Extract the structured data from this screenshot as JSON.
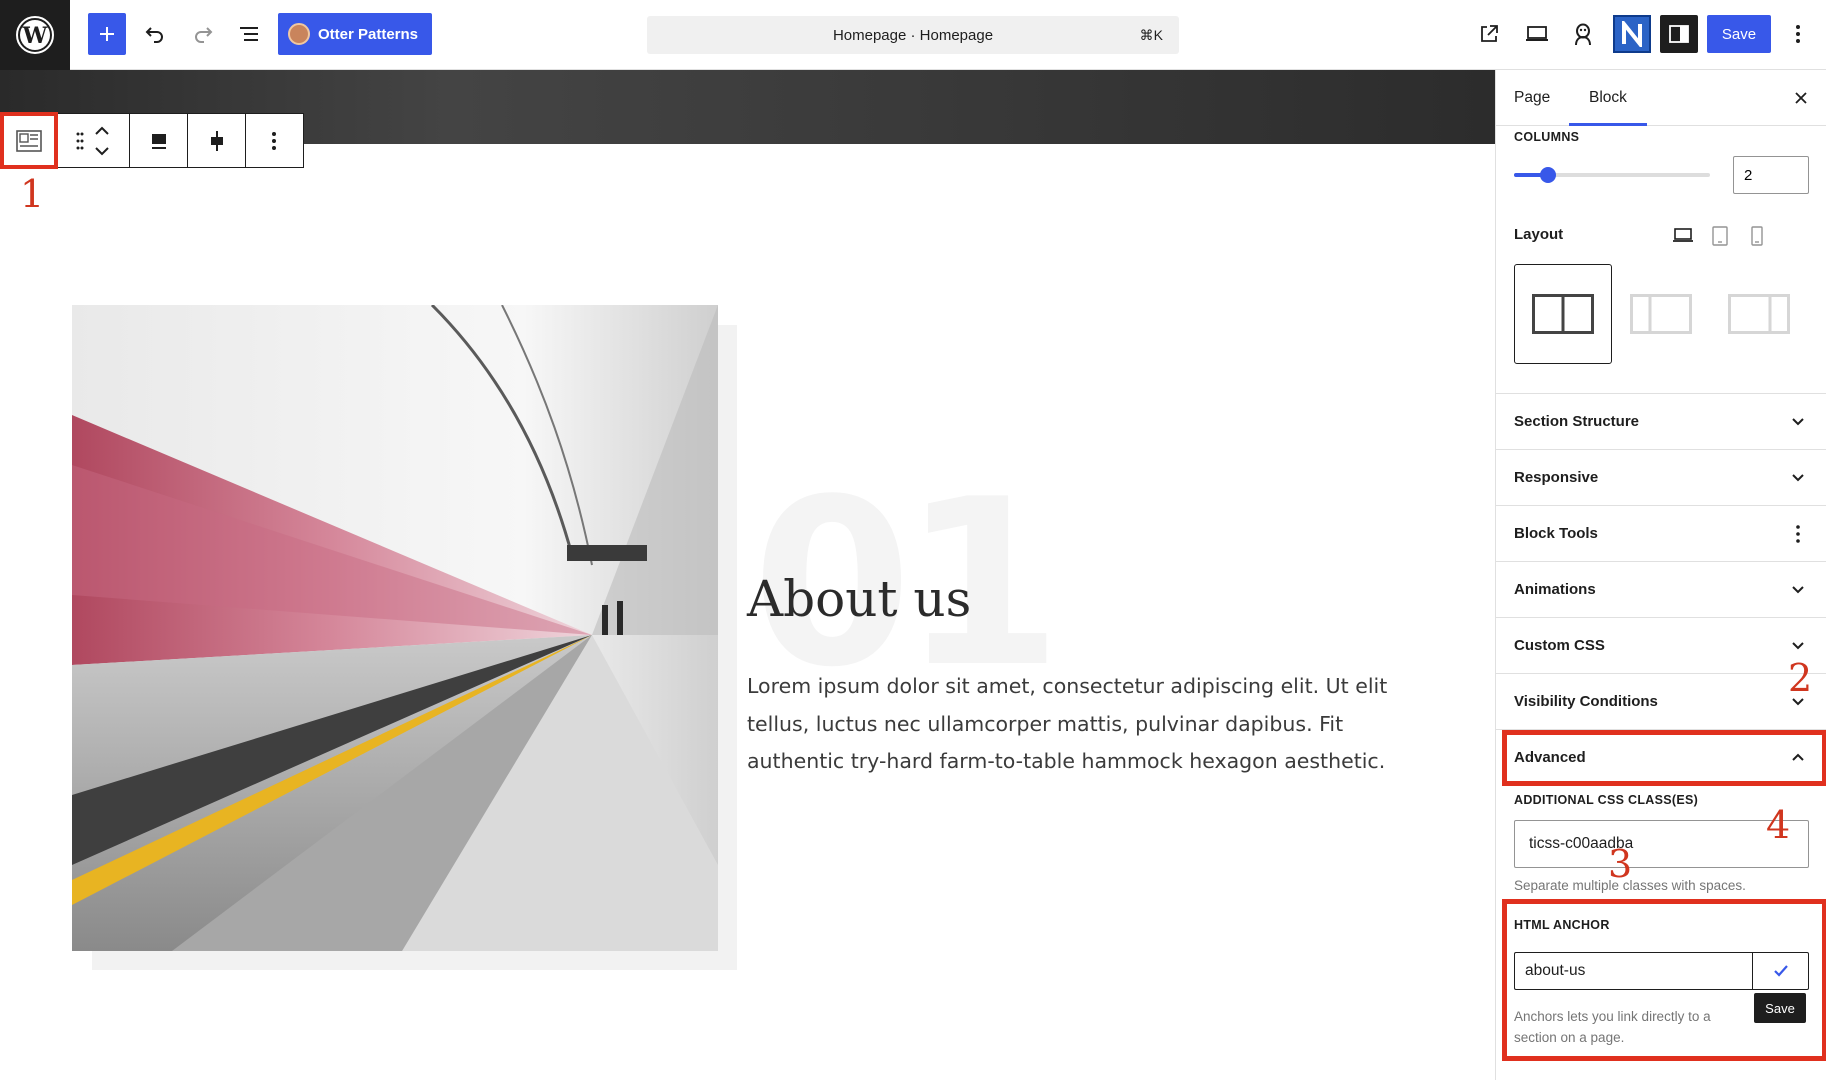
{
  "topbar": {
    "otter_label": "Otter Patterns",
    "command_title": "Homepage · Homepage",
    "command_shortcut": "⌘K",
    "save_label": "Save"
  },
  "annotations": [
    "1",
    "2",
    "3",
    "4"
  ],
  "content": {
    "big_number": "01",
    "title": "About us",
    "body": "Lorem ipsum dolor sit amet, consectetur adipiscing elit. Ut elit tellus, luctus nec ullamcorper mattis, pulvinar dapibus. Fit authentic try-hard farm-to-table hammock hexagon aesthetic."
  },
  "sidebar": {
    "tabs": [
      "Page",
      "Block"
    ],
    "active_tab": "Block",
    "columns": {
      "label": "COLUMNS",
      "value": "2",
      "slider_fraction": 0.175
    },
    "layout_label": "Layout",
    "panels": [
      "Section Structure",
      "Responsive",
      "Block Tools",
      "Animations",
      "Custom CSS",
      "Visibility Conditions",
      "Advanced"
    ],
    "advanced": {
      "css_label": "ADDITIONAL CSS CLASS(ES)",
      "css_value": "ticss-c00aadba",
      "css_help": "Separate multiple classes with spaces.",
      "anchor_label": "HTML ANCHOR",
      "anchor_value": "about-us",
      "tooltip": "Save",
      "anchor_help": "Anchors lets you link directly to a section on a page."
    }
  },
  "colors": {
    "accent": "#3858e9",
    "annotation": "#e0301e"
  }
}
